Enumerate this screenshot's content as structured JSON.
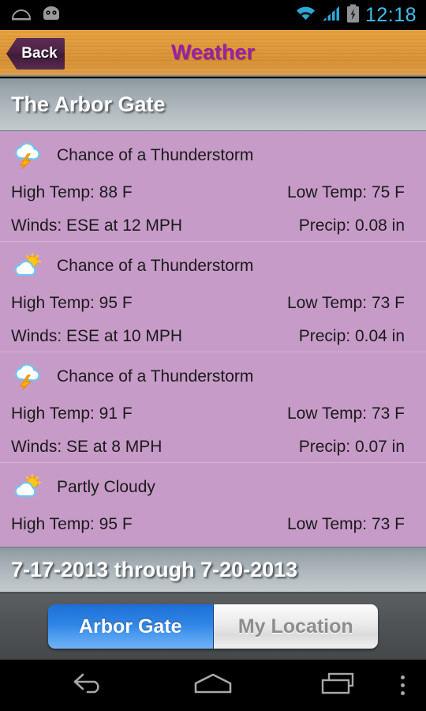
{
  "status_bar": {
    "time": "12:18",
    "left_icons": [
      "dome-icon",
      "android-head-icon"
    ],
    "right_icons": [
      "wifi-icon",
      "signal-icon",
      "battery-charging-icon"
    ],
    "accent_color": "#3ec0ef"
  },
  "title_bar": {
    "back_label": "Back",
    "title": "Weather",
    "title_color": "#9b1fa8",
    "background_color": "#e09a39"
  },
  "location_bar": {
    "name": "The Arbor Gate"
  },
  "forecast": {
    "row_background": "#c79bc8",
    "rows": [
      {
        "icon": "thunderstorm-icon",
        "condition": "Chance of a Thunderstorm",
        "high": "High Temp: 88 F",
        "low": "Low Temp: 75 F",
        "winds": "Winds: ESE at 12 MPH",
        "precip": "Precip: 0.08 in"
      },
      {
        "icon": "partly-cloudy-icon",
        "condition": "Chance of a Thunderstorm",
        "high": "High Temp: 95 F",
        "low": "Low Temp: 73 F",
        "winds": "Winds: ESE at 10 MPH",
        "precip": "Precip: 0.04 in"
      },
      {
        "icon": "thunderstorm-icon",
        "condition": "Chance of a Thunderstorm",
        "high": "High Temp: 91 F",
        "low": "Low Temp: 73 F",
        "winds": "Winds: SE at 8 MPH",
        "precip": "Precip: 0.07 in"
      },
      {
        "icon": "partly-cloudy-icon",
        "condition": "Partly Cloudy",
        "high": "High Temp: 95 F",
        "low": "Low Temp: 73 F",
        "winds": "",
        "precip": ""
      }
    ]
  },
  "dates_bar": {
    "range": "7-17-2013 through 7-20-2013"
  },
  "toolbar": {
    "segments": [
      {
        "label": "Arbor Gate",
        "selected": true
      },
      {
        "label": "My Location",
        "selected": false
      }
    ],
    "active_color": "#2f85e6"
  },
  "nav_bar": {
    "items": [
      "back-icon",
      "home-icon",
      "recents-icon",
      "overflow-menu-icon"
    ]
  }
}
